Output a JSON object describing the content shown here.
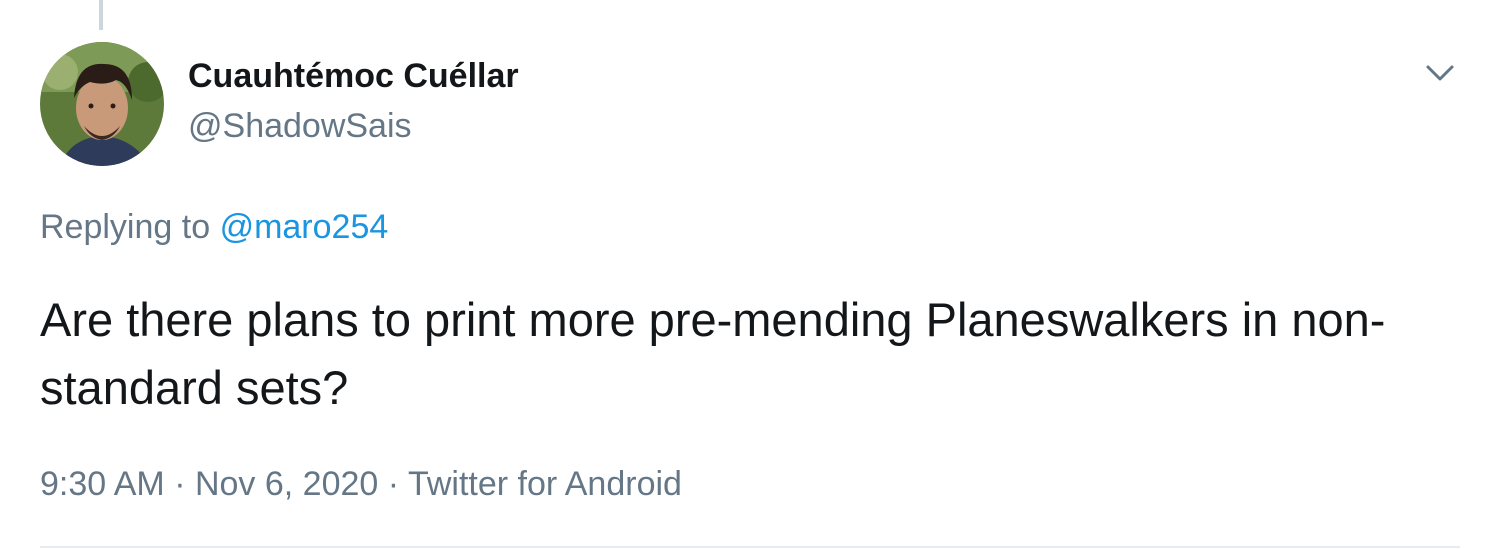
{
  "author": {
    "display_name": "Cuauhtémoc Cuéllar",
    "handle": "@ShadowSais",
    "avatar_icon": "user-avatar-photo"
  },
  "reply_context": {
    "prefix": "Replying to",
    "mention": "@maro254"
  },
  "tweet": {
    "text": "Are there plans to print more pre-mending Planeswalkers in non-standard sets?"
  },
  "meta": {
    "time": "9:30 AM",
    "separator": " · ",
    "date": "Nov 6, 2020",
    "source": "Twitter for Android"
  },
  "icons": {
    "menu": "chevron-down-icon"
  },
  "colors": {
    "text_primary": "#14171a",
    "text_secondary": "#657786",
    "link": "#1b95e0",
    "divider": "#e6ecf0"
  }
}
